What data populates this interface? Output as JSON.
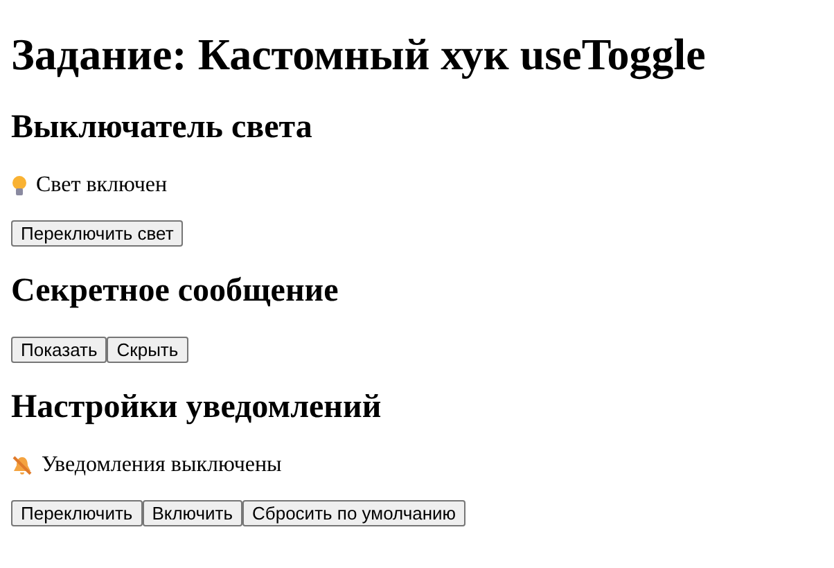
{
  "title": "Задание: Кастомный хук useToggle",
  "sections": [
    {
      "heading": "Выключатель света",
      "status": {
        "kind": "bulb",
        "on": true,
        "text": "Свет включен"
      },
      "buttons": [
        "Переключить свет"
      ]
    },
    {
      "heading": "Секретное сообщение",
      "buttons": [
        "Показать",
        "Скрыть"
      ]
    },
    {
      "heading": "Настройки уведомлений",
      "status": {
        "kind": "bell",
        "on": false,
        "text": "Уведомления выключены"
      },
      "buttons": [
        "Переключить",
        "Включить",
        "Сбросить по умолчанию"
      ]
    }
  ]
}
